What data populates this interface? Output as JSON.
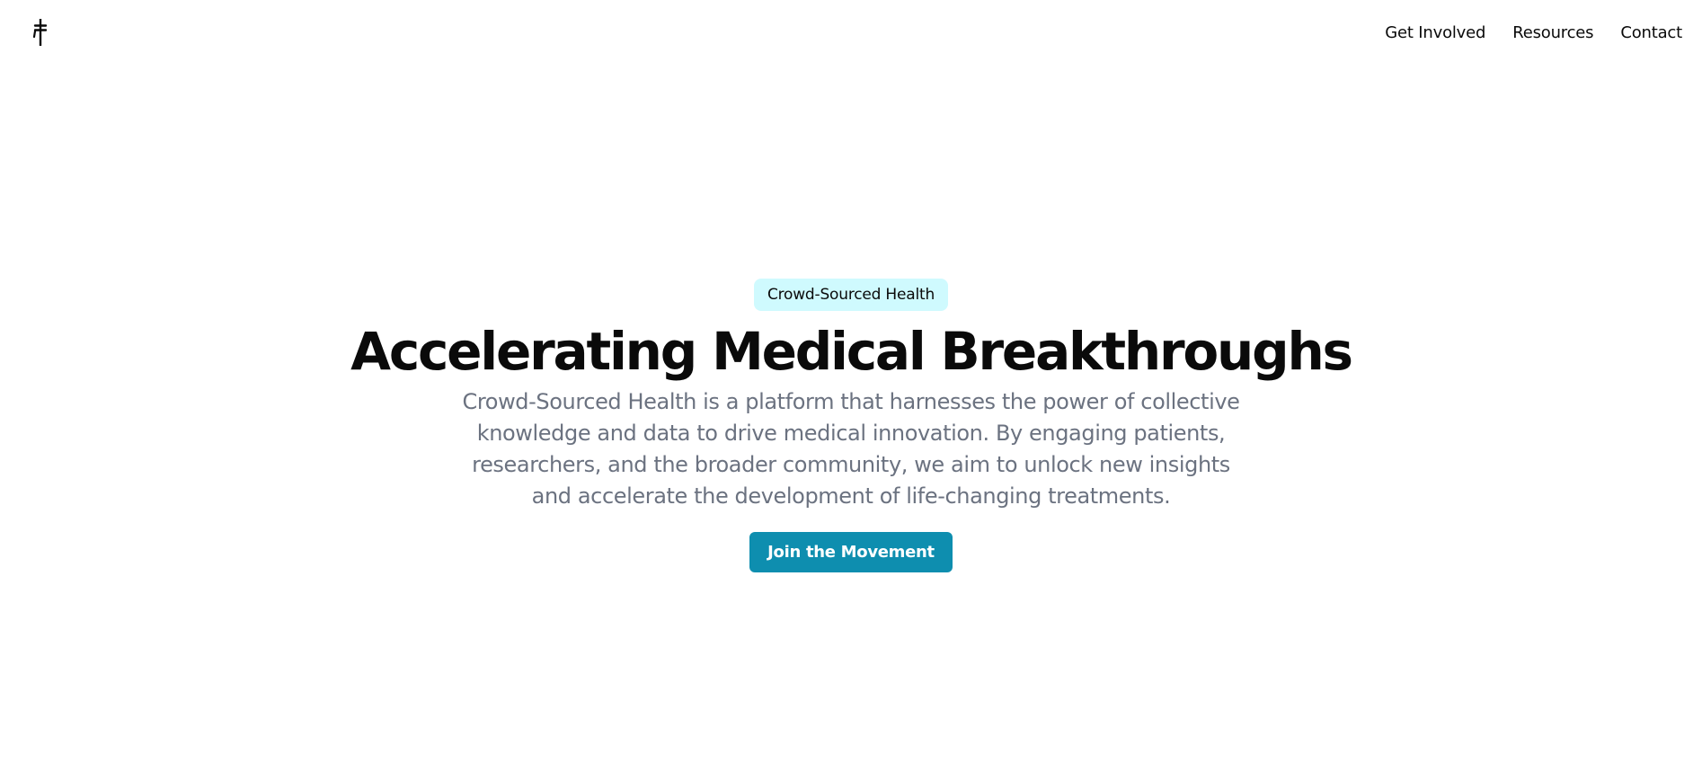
{
  "header": {
    "logo_icon": "cross-icon",
    "nav": [
      {
        "label": "Get Involved"
      },
      {
        "label": "Resources"
      },
      {
        "label": "Contact"
      }
    ]
  },
  "hero": {
    "badge": "Crowd-Sourced Health",
    "title": "Accelerating Medical Breakthroughs",
    "description": "Crowd-Sourced Health is a platform that harnesses the power of collective knowledge and data to drive medical innovation. By engaging patients, researchers, and the broader community, we aim to unlock new insights and accelerate the development of life-changing treatments.",
    "cta_label": "Join the Movement"
  },
  "colors": {
    "badge_bg": "#cffafe",
    "cta_bg": "#0e8eaf",
    "body_text": "#6b7280",
    "heading_text": "#0a0a0a"
  }
}
